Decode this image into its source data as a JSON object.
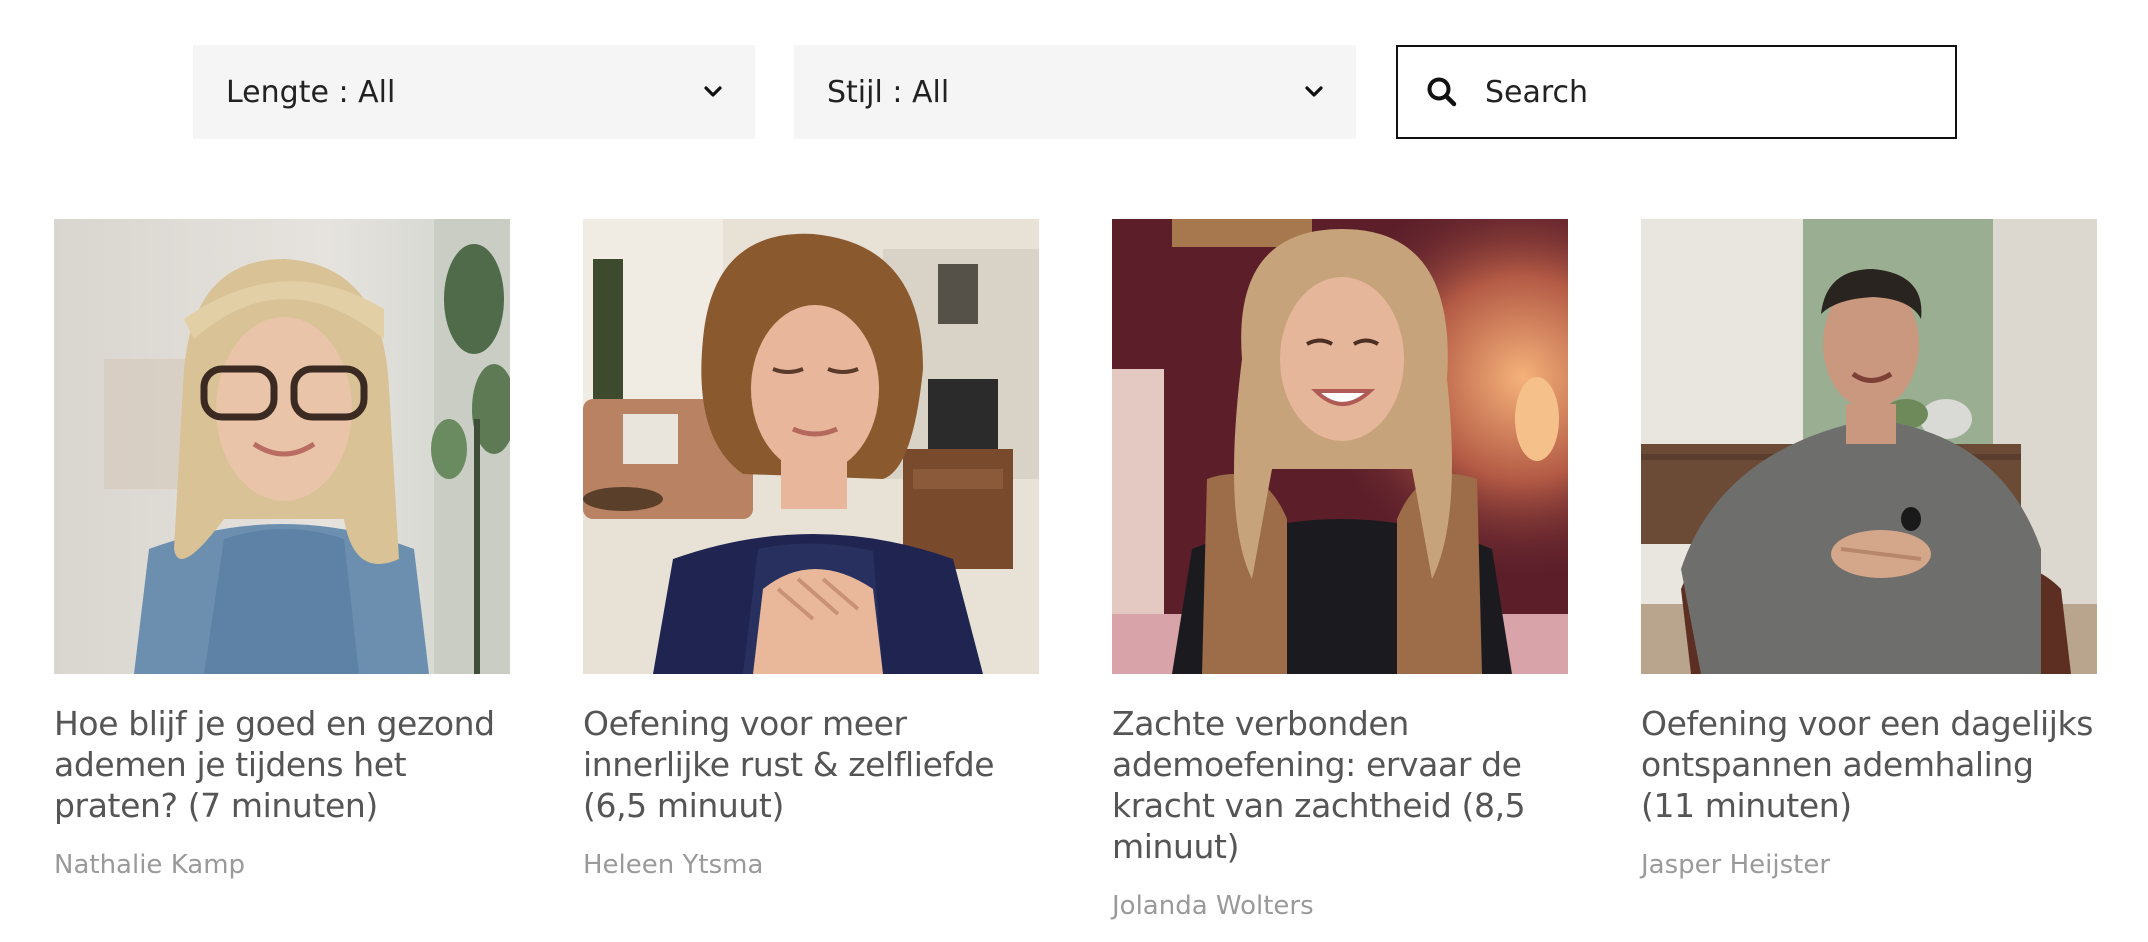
{
  "filters": {
    "length": {
      "label": "Lengte : All"
    },
    "style": {
      "label": "Stijl : All"
    },
    "search": {
      "placeholder": "Search"
    }
  },
  "cards": [
    {
      "title": "Hoe blijf je goed en gezond ademen je tijdens het praten? (7 minuten)",
      "author": "Nathalie Kamp"
    },
    {
      "title": "Oefening voor meer innerlijke rust & zelfliefde (6,5 minuut)",
      "author": "Heleen Ytsma"
    },
    {
      "title": "Zachte verbonden ademoefening: ervaar de kracht van zachtheid (8,5 minuut)",
      "author": "Jolanda Wolters"
    },
    {
      "title": "Oefening voor een dagelijks ontspannen ademhaling (11 minuten)",
      "author": "Jasper Heijster"
    }
  ],
  "colors": {
    "filter_bg": "#f4f5f4",
    "text": "#555555",
    "author": "#9a9a9a",
    "search_border": "#111111"
  }
}
